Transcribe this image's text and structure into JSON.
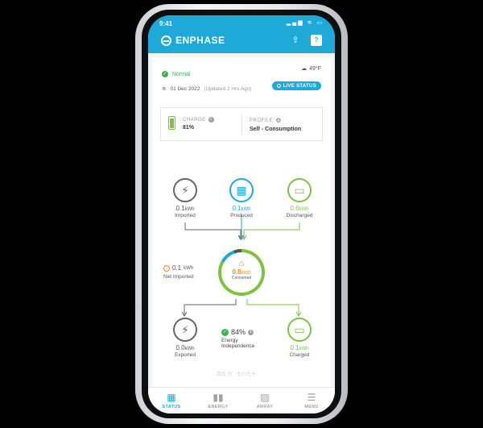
{
  "status_bar": {
    "time": "9:41",
    "icons": "▂▄▆ ≋ ▭"
  },
  "header": {
    "brand": "ENPHASE"
  },
  "system": {
    "status": "Normal",
    "weather_temp": "49°F",
    "date": "01 Dec 2022",
    "updated": "(Updated 2 Hrs Ago)",
    "live_status_label": "LIVE STATUS"
  },
  "charge": {
    "label": "CHARGE",
    "value": "81%",
    "level": 0.81
  },
  "profile": {
    "label": "PROFILE",
    "value": "Self - Consumption"
  },
  "nodes": {
    "imported": {
      "value": "0.1",
      "unit": "kWh",
      "label": "Imported"
    },
    "produced": {
      "value": "0.1",
      "unit": "kWh",
      "label": "Produced"
    },
    "discharged": {
      "value": "0.6",
      "unit": "kWh",
      "label": "Discharged"
    },
    "consumed": {
      "value": "0.8",
      "unit": "kWh",
      "label": "Consumed"
    },
    "net_imported": {
      "value": "0.1",
      "unit": "kWh",
      "label": "Net Imported"
    },
    "exported": {
      "value": "0.0",
      "unit": "kWh",
      "label": "Exported"
    },
    "charged": {
      "value": "0.1",
      "unit": "kWh",
      "label": "Charged"
    }
  },
  "independence": {
    "value": "84%",
    "label_line1": "Energy",
    "label_line2": "Independence"
  },
  "faded_text": "四五 六 · 七八九十",
  "tabs": [
    {
      "label": "STATUS",
      "icon": "status-icon"
    },
    {
      "label": "ENERGY",
      "icon": "energy-icon"
    },
    {
      "label": "ARRAY",
      "icon": "array-icon"
    },
    {
      "label": "MENU",
      "icon": "menu-icon"
    }
  ],
  "colors": {
    "brand_blue": "#1fa9d9",
    "green": "#7ec242",
    "status_green": "#39b54a",
    "orange": "#f08a24",
    "grid_gray": "#555555"
  }
}
